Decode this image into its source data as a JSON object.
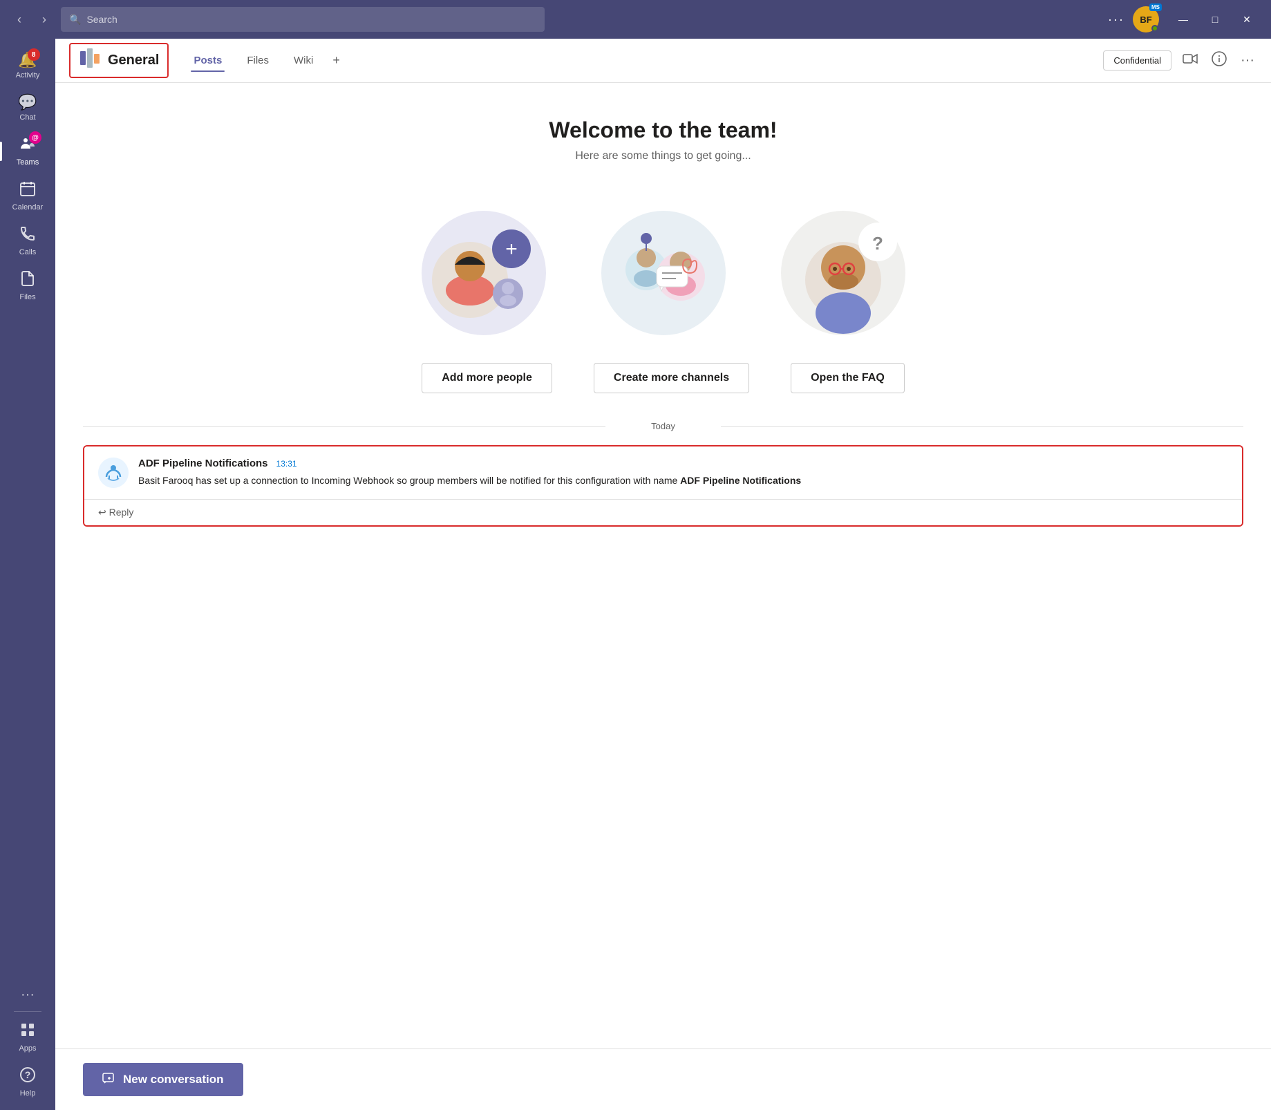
{
  "titlebar": {
    "search_placeholder": "Search",
    "more_label": "···",
    "avatar_initials": "BF",
    "avatar_ms_badge": "MS",
    "minimize": "—",
    "maximize": "□",
    "close": "✕"
  },
  "sidebar": {
    "items": [
      {
        "id": "activity",
        "label": "Activity",
        "icon": "🔔",
        "badge": "8"
      },
      {
        "id": "chat",
        "label": "Chat",
        "icon": "💬",
        "badge": null
      },
      {
        "id": "teams",
        "label": "Teams",
        "icon": "👥",
        "badge": null,
        "active": true
      },
      {
        "id": "calendar",
        "label": "Calendar",
        "icon": "📅",
        "badge": null
      },
      {
        "id": "calls",
        "label": "Calls",
        "icon": "📞",
        "badge": null
      },
      {
        "id": "files",
        "label": "Files",
        "icon": "📄",
        "badge": null
      }
    ],
    "more_label": "···",
    "apps_label": "Apps",
    "help_label": "Help"
  },
  "channel_header": {
    "channel_name": "General",
    "tabs": [
      {
        "id": "posts",
        "label": "Posts",
        "active": true
      },
      {
        "id": "files",
        "label": "Files",
        "active": false
      },
      {
        "id": "wiki",
        "label": "Wiki",
        "active": false
      }
    ],
    "tab_add": "+",
    "confidential_label": "Confidential",
    "video_icon": "📹",
    "info_icon": "ℹ",
    "more_label": "···"
  },
  "welcome": {
    "title": "Welcome to the team!",
    "subtitle": "Here are some things to get going..."
  },
  "action_buttons": [
    {
      "id": "add-people",
      "label": "Add more people"
    },
    {
      "id": "create-channels",
      "label": "Create more channels"
    },
    {
      "id": "open-faq",
      "label": "Open the FAQ"
    }
  ],
  "date_divider": "Today",
  "message": {
    "sender": "ADF Pipeline Notifications",
    "time": "13:31",
    "body_prefix": "Basit Farooq has set up a connection to Incoming Webhook so group members will be notified for this configuration with name ",
    "body_bold": "ADF Pipeline Notifications",
    "reply_label": "↩ Reply"
  },
  "new_conversation": {
    "button_label": "New conversation"
  }
}
